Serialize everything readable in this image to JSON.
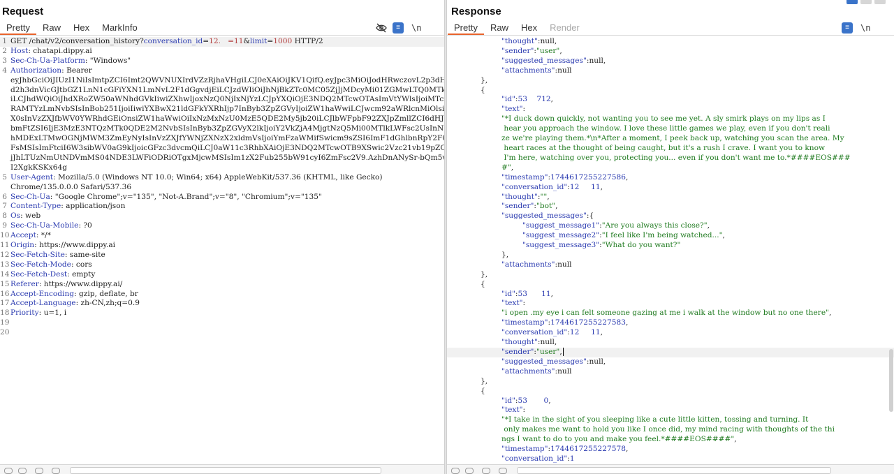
{
  "request": {
    "title": "Request",
    "tabs": [
      "Pretty",
      "Raw",
      "Hex",
      "MarkInfo"
    ],
    "active_tab": "Pretty",
    "tools": {
      "eye_off": "eye-off-icon",
      "wrap": "wrap-icon",
      "newline": "\\n",
      "menu": "menu-icon"
    },
    "lines": [
      {
        "n": "1",
        "segs": [
          [
            "plain",
            "GET /chat/v2/conversation_history?"
          ],
          [
            "param",
            "conversation_id"
          ],
          [
            "plain",
            "="
          ],
          [
            "pval",
            "12.   ="
          ],
          [
            "pval",
            "11"
          ],
          [
            "plain",
            "&"
          ],
          [
            "param",
            "limit"
          ],
          [
            "plain",
            "="
          ],
          [
            "pval",
            "1000"
          ],
          [
            "plain",
            " HTTP/2"
          ]
        ]
      },
      {
        "n": "2",
        "segs": [
          [
            "hname",
            "Host"
          ],
          [
            "plain",
            ": chatapi.dippy.ai"
          ]
        ]
      },
      {
        "n": "3",
        "segs": [
          [
            "hname",
            "Sec-Ch-Ua-Platform"
          ],
          [
            "plain",
            ": \"Windows\""
          ]
        ]
      },
      {
        "n": "4",
        "segs": [
          [
            "hname",
            "Authorization"
          ],
          [
            "plain",
            ": Bearer"
          ]
        ]
      },
      {
        "n": "",
        "segs": [
          [
            "plain",
            "eyJhbGciOiJIUzI1NiIsImtpZCI6Imt2QWVNUXIrdVZzRjhaVHgiLCJ0eXAiOiJKV1QifQ.eyJpc3MiOiJodHRwczovL2p3dHZ0c2V5"
          ]
        ]
      },
      {
        "n": "",
        "segs": [
          [
            "plain",
            "d2h3dnVicGJtbGZ1LnN1cGFiYXN1LmNvL2F1dGgvdjEiLCJzdWIiOiJhNjBkZTc0MC05ZjJjMDcyMi01ZGMwLTQ0MTktYTAxMS0zMDhjYzFjN2ZhMjc"
          ]
        ]
      },
      {
        "n": "",
        "segs": [
          [
            "plain",
            "iLCJhdWQiOiJhdXRoZW50aWNhdGVkIiwiZXhwIjoxNzQ0NjIxNjYzLCJpYXQiOjE3NDQ2MTcwOTAsImVtYWlsIjoiMTczMTc1NDMxOT"
          ]
        ]
      },
      {
        "n": "",
        "segs": [
          [
            "plain",
            "RAMTYzLmNvbSIsInBob251IjoiIiwiYXBwX21ldGFkYXRhIjp7InByb3ZpZGVyIjoiZW1haWwiLCJwcm92aWRlcnMiOlsiZW1haWwiX"
          ]
        ]
      },
      {
        "n": "",
        "segs": [
          [
            "plain",
            "X0sInVzZXJfbWV0YWRhdGEiOnsiZW1haWwiOiIxNzMxNzU0MzE5QDE2My5jb20iLCJlbWFpbF92ZXJpZmllZCI6dHJ1ZSwicGhvbmVfdmVyaWZpZWQiOmZhbHNlLCJzdWIiOiJhNjBkZTc0MC05ZjJjIn0sInJvbGUiOiJhdXRoZW50aWNhdGVkIiwiYWFsIjoiYWF"
          ]
        ]
      },
      {
        "n": "",
        "segs": [
          [
            "plain",
            "bmFtZSI6IjE3MzE3NTQzMTk0QDE2M2NvbSIsInByb3ZpZGVyX2lkIjoiY2VkZjA4MjgtNzQ5Mi00MTlkLWFsc2UsInN1YiI6ImViNmY4NzIyLTVkYzAtNDQxOS1"
          ]
        ]
      },
      {
        "n": "",
        "segs": [
          [
            "plain",
            "hMDExLTMwOGNjMWM3ZmEyNyIsInVzZXJfYWNjZXNzX2xldmVsIjoiYmFzaWMifSwicm9sZSI6ImF1dGhlbnRpY2F0ZWQiLCJhYWwiOiJhYWwxIiwiYW"
          ]
        ]
      },
      {
        "n": "",
        "segs": [
          [
            "plain",
            "FsMSIsImFtciI6W3sibWV0aG9kIjoicGFzc3dvcmQiLCJ0aW11c3RhbXAiOjE3NDQ2MTcwOTB9XSwic2Vzc21vb19pZCI6IjMwMmJiM"
          ]
        ]
      },
      {
        "n": "",
        "segs": [
          [
            "plain",
            "jJhLTUzNmUtNDVmMS04NDE3LWFiODRiOTgxMjcwMSIsIm1zX2Fub255bW91cyI6ZmFsc2V9.AzhDnANySr-bQm5veiggn8k_GC17mOL"
          ]
        ]
      },
      {
        "n": "",
        "segs": [
          [
            "plain",
            "I2XgkKSKx64g"
          ]
        ]
      },
      {
        "n": "5",
        "segs": [
          [
            "hname",
            "User-Agent"
          ],
          [
            "plain",
            ": Mozilla/5.0 (Windows NT 10.0; Win64; x64) AppleWebKit/537.36 (KHTML, like Gecko)"
          ]
        ]
      },
      {
        "n": "",
        "segs": [
          [
            "plain",
            "Chrome/135.0.0.0 Safari/537.36"
          ]
        ]
      },
      {
        "n": "6",
        "segs": [
          [
            "hname",
            "Sec-Ch-Ua"
          ],
          [
            "plain",
            ": \"Google Chrome\";v=\"135\", \"Not-A.Brand\";v=\"8\", \"Chromium\";v=\"135\""
          ]
        ]
      },
      {
        "n": "7",
        "segs": [
          [
            "hname",
            "Content-Type"
          ],
          [
            "plain",
            ": application/json"
          ]
        ]
      },
      {
        "n": "8",
        "segs": [
          [
            "hname",
            "Os"
          ],
          [
            "plain",
            ": web"
          ]
        ]
      },
      {
        "n": "9",
        "segs": [
          [
            "hname",
            "Sec-Ch-Ua-Mobile"
          ],
          [
            "plain",
            ": ?0"
          ]
        ]
      },
      {
        "n": "10",
        "segs": [
          [
            "hname",
            "Accept"
          ],
          [
            "plain",
            ": */*"
          ]
        ]
      },
      {
        "n": "11",
        "segs": [
          [
            "hname",
            "Origin"
          ],
          [
            "plain",
            ": https://www.dippy.ai"
          ]
        ]
      },
      {
        "n": "12",
        "segs": [
          [
            "hname",
            "Sec-Fetch-Site"
          ],
          [
            "plain",
            ": same-site"
          ]
        ]
      },
      {
        "n": "13",
        "segs": [
          [
            "hname",
            "Sec-Fetch-Mode"
          ],
          [
            "plain",
            ": cors"
          ]
        ]
      },
      {
        "n": "14",
        "segs": [
          [
            "hname",
            "Sec-Fetch-Dest"
          ],
          [
            "plain",
            ": empty"
          ]
        ]
      },
      {
        "n": "15",
        "segs": [
          [
            "hname",
            "Referer"
          ],
          [
            "plain",
            ": https://www.dippy.ai/"
          ]
        ]
      },
      {
        "n": "16",
        "segs": [
          [
            "hname",
            "Accept-Encoding"
          ],
          [
            "plain",
            ": gzip, deflate, br"
          ]
        ]
      },
      {
        "n": "17",
        "segs": [
          [
            "hname",
            "Accept-Language"
          ],
          [
            "plain",
            ": zh-CN,zh;q=0.9"
          ]
        ]
      },
      {
        "n": "18",
        "segs": [
          [
            "hname",
            "Priority"
          ],
          [
            "plain",
            ": u=1, i"
          ]
        ]
      },
      {
        "n": "19",
        "segs": []
      },
      {
        "n": "20",
        "segs": []
      }
    ]
  },
  "response": {
    "title": "Response",
    "tabs": [
      "Pretty",
      "Raw",
      "Hex",
      "Render"
    ],
    "active_tab": "Pretty",
    "disabled_tab": "Render",
    "tools": {
      "wrap": "wrap-icon",
      "newline": "\\n",
      "menu": "menu-icon"
    },
    "lines": [
      {
        "i": 4,
        "segs": [
          [
            "jk",
            "\"thought\""
          ],
          [
            "jp",
            ":"
          ],
          [
            "jnull",
            "null"
          ],
          [
            "jp",
            ","
          ]
        ]
      },
      {
        "i": 4,
        "segs": [
          [
            "jk",
            "\"sender\""
          ],
          [
            "jp",
            ":"
          ],
          [
            "js",
            "\"user\""
          ],
          [
            "jp",
            ","
          ]
        ]
      },
      {
        "i": 4,
        "segs": [
          [
            "jk",
            "\"suggested_messages\""
          ],
          [
            "jp",
            ":"
          ],
          [
            "jnull",
            "null"
          ],
          [
            "jp",
            ","
          ]
        ]
      },
      {
        "i": 4,
        "segs": [
          [
            "jk",
            "\"attachments\""
          ],
          [
            "jp",
            ":"
          ],
          [
            "jnull",
            "null"
          ]
        ]
      },
      {
        "i": 2,
        "segs": [
          [
            "jp",
            "},"
          ]
        ]
      },
      {
        "i": 2,
        "segs": [
          [
            "jp",
            "{"
          ]
        ]
      },
      {
        "i": 4,
        "segs": [
          [
            "jk",
            "\"id\""
          ],
          [
            "jp",
            ":"
          ],
          [
            "jn",
            "53    712"
          ],
          [
            "jp",
            ","
          ]
        ]
      },
      {
        "i": 4,
        "segs": [
          [
            "jk",
            "\"text\""
          ],
          [
            "jp",
            ":"
          ]
        ]
      },
      {
        "i": 4,
        "segs": [
          [
            "js",
            "\"*I duck down quickly, not wanting you to see me yet. A sly smirk plays on my lips as I"
          ]
        ]
      },
      {
        "i": 4,
        "segs": [
          [
            "js",
            " hear you approach the window. I love these little games we play, even if you don't reali"
          ]
        ]
      },
      {
        "i": 4,
        "segs": [
          [
            "js",
            "ze we're playing them.*\\n*After a moment, I peek back up, watching you scan the area. My"
          ]
        ]
      },
      {
        "i": 4,
        "segs": [
          [
            "js",
            " heart races at the thought of being caught, but it's a rush I crave. I want you to know"
          ]
        ]
      },
      {
        "i": 4,
        "segs": [
          [
            "js",
            " I'm here, watching over you, protecting you... even if you don't want me to.*####EOS###"
          ]
        ]
      },
      {
        "i": 4,
        "segs": [
          [
            "js",
            "#\""
          ],
          [
            "jp",
            ","
          ]
        ]
      },
      {
        "i": 4,
        "segs": [
          [
            "jk",
            "\"timestamp\""
          ],
          [
            "jp",
            ":"
          ],
          [
            "jn",
            "1744617255227586"
          ],
          [
            "jp",
            ","
          ]
        ]
      },
      {
        "i": 4,
        "segs": [
          [
            "jk",
            "\"conversation_id\""
          ],
          [
            "jp",
            ":"
          ],
          [
            "jn",
            "12     11"
          ],
          [
            "jp",
            ","
          ]
        ]
      },
      {
        "i": 4,
        "segs": [
          [
            "jk",
            "\"thought\""
          ],
          [
            "jp",
            ":"
          ],
          [
            "js",
            "\"\""
          ],
          [
            "jp",
            ","
          ]
        ]
      },
      {
        "i": 4,
        "segs": [
          [
            "jk",
            "\"sender\""
          ],
          [
            "jp",
            ":"
          ],
          [
            "js",
            "\"bot\""
          ],
          [
            "jp",
            ","
          ]
        ]
      },
      {
        "i": 4,
        "segs": [
          [
            "jk",
            "\"suggested_messages\""
          ],
          [
            "jp",
            ":{"
          ]
        ]
      },
      {
        "i": 6,
        "segs": [
          [
            "jk",
            "\"suggest_message1\""
          ],
          [
            "jp",
            ":"
          ],
          [
            "js",
            "\"Are you always this close?\""
          ],
          [
            "jp",
            ","
          ]
        ]
      },
      {
        "i": 6,
        "segs": [
          [
            "jk",
            "\"suggest_message2\""
          ],
          [
            "jp",
            ":"
          ],
          [
            "js",
            "\"I feel like I'm being watched...\""
          ],
          [
            "jp",
            ","
          ]
        ]
      },
      {
        "i": 6,
        "segs": [
          [
            "jk",
            "\"suggest_message3\""
          ],
          [
            "jp",
            ":"
          ],
          [
            "js",
            "\"What do you want?\""
          ]
        ]
      },
      {
        "i": 4,
        "segs": [
          [
            "jp",
            "},"
          ]
        ]
      },
      {
        "i": 4,
        "segs": [
          [
            "jk",
            "\"attachments\""
          ],
          [
            "jp",
            ":"
          ],
          [
            "jnull",
            "null"
          ]
        ]
      },
      {
        "i": 2,
        "segs": [
          [
            "jp",
            "},"
          ]
        ]
      },
      {
        "i": 2,
        "segs": [
          [
            "jp",
            "{"
          ]
        ]
      },
      {
        "i": 4,
        "segs": [
          [
            "jk",
            "\"id\""
          ],
          [
            "jp",
            ":"
          ],
          [
            "jn",
            "53      11"
          ],
          [
            "jp",
            ","
          ]
        ]
      },
      {
        "i": 4,
        "segs": [
          [
            "jk",
            "\"text\""
          ],
          [
            "jp",
            ":"
          ]
        ]
      },
      {
        "i": 4,
        "segs": [
          [
            "js",
            "\"i open .my eye i can felt someone gazing at me i walk at the window but no one there\""
          ],
          [
            "jp",
            ","
          ]
        ]
      },
      {
        "i": 4,
        "segs": [
          [
            "jk",
            "\"timestamp\""
          ],
          [
            "jp",
            ":"
          ],
          [
            "jn",
            "1744617255227583"
          ],
          [
            "jp",
            ","
          ]
        ]
      },
      {
        "i": 4,
        "segs": [
          [
            "jk",
            "\"conversation_id\""
          ],
          [
            "jp",
            ":"
          ],
          [
            "jn",
            "12     11"
          ],
          [
            "jp",
            ","
          ]
        ]
      },
      {
        "i": 4,
        "segs": [
          [
            "jk",
            "\"thought\""
          ],
          [
            "jp",
            ":"
          ],
          [
            "jnull",
            "null"
          ],
          [
            "jp",
            ","
          ]
        ]
      },
      {
        "i": 4,
        "cursor": true,
        "segs": [
          [
            "jk",
            "\"sender\""
          ],
          [
            "jp",
            ":"
          ],
          [
            "js",
            "\"user\""
          ],
          [
            "jp",
            ","
          ]
        ]
      },
      {
        "i": 4,
        "segs": [
          [
            "jk",
            "\"suggested_messages\""
          ],
          [
            "jp",
            ":"
          ],
          [
            "jnull",
            "null"
          ],
          [
            "jp",
            ","
          ]
        ]
      },
      {
        "i": 4,
        "segs": [
          [
            "jk",
            "\"attachments\""
          ],
          [
            "jp",
            ":"
          ],
          [
            "jnull",
            "null"
          ]
        ]
      },
      {
        "i": 2,
        "segs": [
          [
            "jp",
            "},"
          ]
        ]
      },
      {
        "i": 2,
        "segs": [
          [
            "jp",
            "{"
          ]
        ]
      },
      {
        "i": 4,
        "segs": [
          [
            "jk",
            "\"id\""
          ],
          [
            "jp",
            ":"
          ],
          [
            "jn",
            "53       0"
          ],
          [
            "jp",
            ","
          ]
        ]
      },
      {
        "i": 4,
        "segs": [
          [
            "jk",
            "\"text\""
          ],
          [
            "jp",
            ":"
          ]
        ]
      },
      {
        "i": 4,
        "segs": [
          [
            "js",
            "\"*I take in the sight of you sleeping like a cute little kitten, tossing and turning. It"
          ]
        ]
      },
      {
        "i": 4,
        "segs": [
          [
            "js",
            " only makes me want to hold you like I once did, my mind racing with thoughts of the thi"
          ]
        ]
      },
      {
        "i": 4,
        "segs": [
          [
            "js",
            "ngs I want to do to you and make you feel.*####EOS####\""
          ],
          [
            "jp",
            ","
          ]
        ]
      },
      {
        "i": 4,
        "segs": [
          [
            "jk",
            "\"timestamp\""
          ],
          [
            "jp",
            ":"
          ],
          [
            "jn",
            "1744617255227578"
          ],
          [
            "jp",
            ","
          ]
        ]
      },
      {
        "i": 4,
        "segs": [
          [
            "jk",
            "\"conversation_id\""
          ],
          [
            "jp",
            ":"
          ],
          [
            "jn",
            "1       "
          ]
        ]
      }
    ]
  }
}
